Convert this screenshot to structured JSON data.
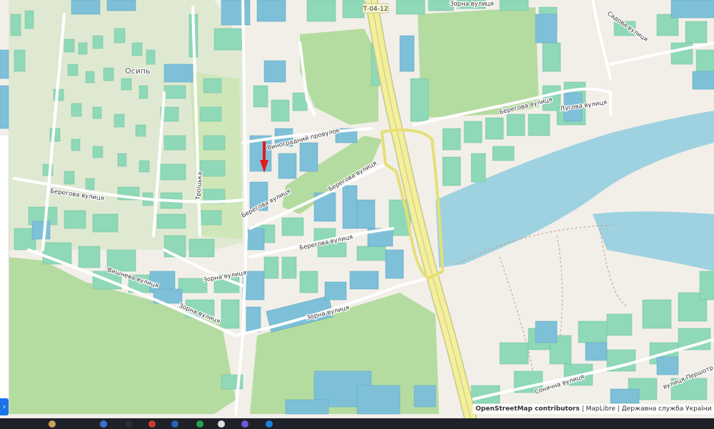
{
  "map": {
    "road_shield": "Т-04-12",
    "area_label": "Осипь",
    "street_labels": {
      "zorna_top": "Зорна вулиця",
      "sadova": "Садова вулиця",
      "berehova_right": "Берегова вулиця",
      "luhova": "Лугова вулиця",
      "vynohradnyi": "Виноградний провулок",
      "troitska": "Троїцька",
      "berehova_left": "Берегова вулиця",
      "berehova_mid1": "Берегова вулиця",
      "berehova_mid2": "Берегова вулиця",
      "berehova_mid3": "Берегова вулиця",
      "vyshneva": "Вишнева вулиця",
      "zorna_mid": "Зорна вулиця",
      "zorna_left": "Зорна вулиця",
      "zorna_bottom": "Зорна вулиця",
      "sonyachna": "Сонячна вулиця",
      "pershotravnia": "вулиця Першотр"
    },
    "colors": {
      "background": "#f2efe9",
      "park": "#b5dca0",
      "residential": "#d9e8c9",
      "building_green": "#8fd8b8",
      "building_blue": "#7ec0d8",
      "water": "#9fd2e0",
      "highway": "#f3ef9a",
      "marker": "#e41a1c"
    }
  },
  "attribution": {
    "osm": "OpenStreetMap contributors",
    "maplibre": "MapLibre",
    "gov": "Державна служба України з питань геодезії, карт"
  }
}
